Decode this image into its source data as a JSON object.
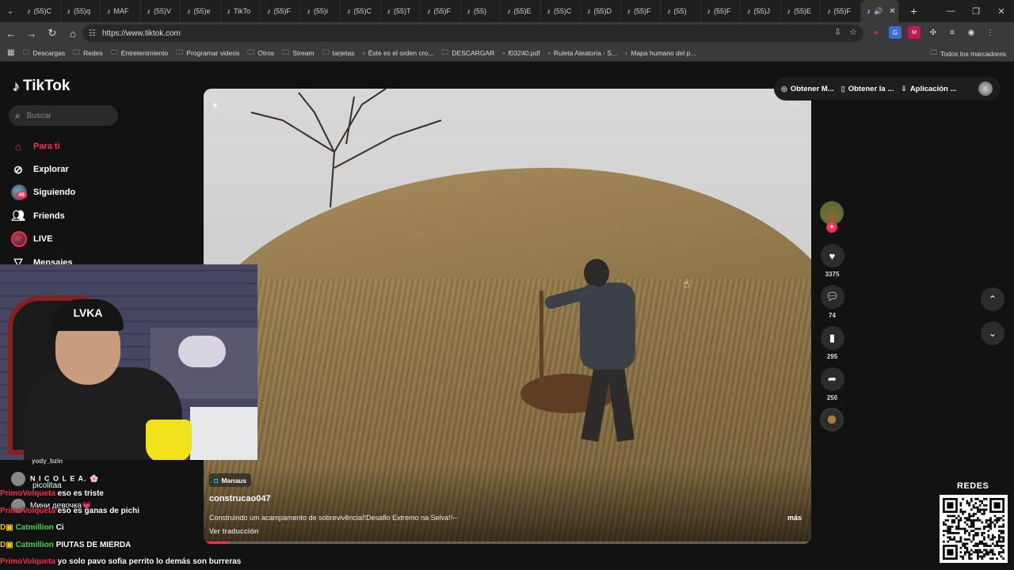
{
  "browser": {
    "tabs": [
      {
        "label": "(55)C"
      },
      {
        "label": "(55)q"
      },
      {
        "label": "MAF"
      },
      {
        "label": "(55)V"
      },
      {
        "label": "(55)e"
      },
      {
        "label": "TikTo"
      },
      {
        "label": "(55)F"
      },
      {
        "label": "(55)i"
      },
      {
        "label": "(55)C"
      },
      {
        "label": "(55)T"
      },
      {
        "label": "(55)F"
      },
      {
        "label": "(55)"
      },
      {
        "label": "(55)E"
      },
      {
        "label": "(55)C"
      },
      {
        "label": "(55)D"
      },
      {
        "label": "(55)F"
      },
      {
        "label": "(55)"
      },
      {
        "label": "(55)F"
      },
      {
        "label": "(55)J"
      },
      {
        "label": "(55)E"
      },
      {
        "label": "(55)F"
      }
    ],
    "url": "https://www.tiktok.com",
    "bookmarks": [
      {
        "label": "Descargas",
        "icon": "folder-icon"
      },
      {
        "label": "Redes",
        "icon": "folder-icon"
      },
      {
        "label": "Entretenimiento",
        "icon": "folder-icon"
      },
      {
        "label": "Programar videos",
        "icon": "folder-icon"
      },
      {
        "label": "Otros",
        "icon": "folder-icon"
      },
      {
        "label": "Stream",
        "icon": "folder-icon"
      },
      {
        "label": "tarjetas",
        "icon": "folder-icon"
      },
      {
        "label": "Éste es el orden cro...",
        "icon": "page-icon"
      },
      {
        "label": "DESCARGAR",
        "icon": "folder-icon"
      },
      {
        "label": "f03240.pdf",
        "icon": "page-icon"
      },
      {
        "label": "Ruleta Aleatoria - S...",
        "icon": "page-icon"
      },
      {
        "label": "Mapa humano del p...",
        "icon": "page-icon"
      }
    ],
    "all_bookmarks": "Todos los marcadores"
  },
  "tiktok": {
    "logo": "TikTok",
    "search_placeholder": "Buscar",
    "nav": [
      {
        "label": "Para ti",
        "icon": "home-icon",
        "active": true
      },
      {
        "label": "Explorar",
        "icon": "compass-icon"
      },
      {
        "label": "Siguiendo",
        "icon": "following-avatar"
      },
      {
        "label": "Friends",
        "icon": "friends-icon"
      },
      {
        "label": "LIVE",
        "icon": "live-avatar"
      },
      {
        "label": "Mensajes",
        "icon": "messages-icon"
      }
    ],
    "messages_badge": "49",
    "header": {
      "get_coins": "Obtener M...",
      "get_app": "Obtener la ...",
      "app": "Aplicación ..."
    },
    "video": {
      "location": "Manaus",
      "author": "construcao047",
      "description": "Construindo um acampamento de sobrevivência!!Desafio Extremo na Selva!!--",
      "more": "más",
      "translate": "Ver traducción",
      "progress": 0.04
    },
    "actions": {
      "likes": "3375",
      "comments": "74",
      "saves": "295",
      "shares": "250"
    }
  },
  "stream_overlay": {
    "chat": [
      {
        "user": "yody_bzin",
        "text": "",
        "style": "plain"
      },
      {
        "user": "N I C O L E A. 🌸",
        "text": "picolitaa",
        "style": "avatar"
      },
      {
        "user": "PrimoVolqueta",
        "text": "eso es triste",
        "style": "pink"
      },
      {
        "user": "",
        "text": "Мини девочка💗",
        "style": "plain"
      },
      {
        "user": "PrimoVolqueta",
        "text": "eso es ganas de pichi",
        "style": "pink"
      },
      {
        "user": "Catmillion",
        "text": "Ci",
        "style": "green"
      },
      {
        "user": "Catmillion",
        "text": "PIUTAS DE MIERDA",
        "style": "green"
      },
      {
        "user": "PrimoVolqueta",
        "text": "yo solo pavo sofia perrito lo demás son burreras",
        "style": "pink"
      }
    ],
    "redes_label": "REDES"
  }
}
